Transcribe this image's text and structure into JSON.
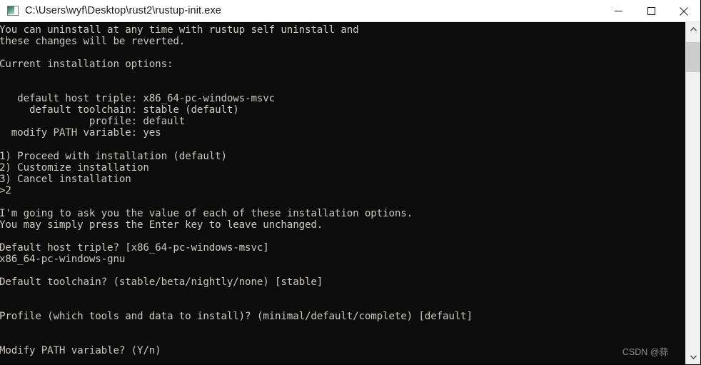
{
  "window": {
    "title": "C:\\Users\\wyf\\Desktop\\rust2\\rustup-init.exe",
    "icon": "console-window-icon",
    "background_color": "#0c0c0c",
    "titlebar_color": "#ffffff",
    "text_color": "#ccc9c4"
  },
  "titlebar": {
    "minimize_label": "Minimize",
    "maximize_label": "Maximize",
    "close_label": "Close"
  },
  "scrollbar": {
    "up_arrow": "scroll-up-arrow",
    "down_arrow": "scroll-down-arrow",
    "thumb": "scroll-thumb"
  },
  "watermark": {
    "text": "CSDN @蒜"
  },
  "console": {
    "lines": [
      "You can uninstall at any time with rustup self uninstall and",
      "these changes will be reverted.",
      "",
      "Current installation options:",
      "",
      "",
      "   default host triple: x86_64-pc-windows-msvc",
      "     default toolchain: stable (default)",
      "               profile: default",
      "  modify PATH variable: yes",
      "",
      "1) Proceed with installation (default)",
      "2) Customize installation",
      "3) Cancel installation",
      ">2",
      "",
      "I'm going to ask you the value of each of these installation options.",
      "You may simply press the Enter key to leave unchanged.",
      "",
      "Default host triple? [x86_64-pc-windows-msvc]",
      "x86_64-pc-windows-gnu",
      "",
      "Default toolchain? (stable/beta/nightly/none) [stable]",
      "",
      "",
      "Profile (which tools and data to install)? (minimal/default/complete) [default]",
      "",
      "",
      "Modify PATH variable? (Y/n)"
    ],
    "text": "You can uninstall at any time with rustup self uninstall and\nthese changes will be reverted.\n\nCurrent installation options:\n\n\n   default host triple: x86_64-pc-windows-msvc\n     default toolchain: stable (default)\n               profile: default\n  modify PATH variable: yes\n\n1) Proceed with installation (default)\n2) Customize installation\n3) Cancel installation\n>2\n\nI'm going to ask you the value of each of these installation options.\nYou may simply press the Enter key to leave unchanged.\n\nDefault host triple? [x86_64-pc-windows-msvc]\nx86_64-pc-windows-gnu\n\nDefault toolchain? (stable/beta/nightly/none) [stable]\n\n\nProfile (which tools and data to install)? (minimal/default/complete) [default]\n\n\nModify PATH variable? (Y/n)",
    "installation_options": {
      "default_host_triple": "x86_64-pc-windows-msvc",
      "default_toolchain": "stable (default)",
      "profile": "default",
      "modify_path_variable": "yes"
    },
    "menu_choices": [
      "1) Proceed with installation (default)",
      "2) Customize installation",
      "3) Cancel installation"
    ],
    "user_input": ">2",
    "answers": {
      "host_triple": "x86_64-pc-windows-gnu"
    }
  }
}
